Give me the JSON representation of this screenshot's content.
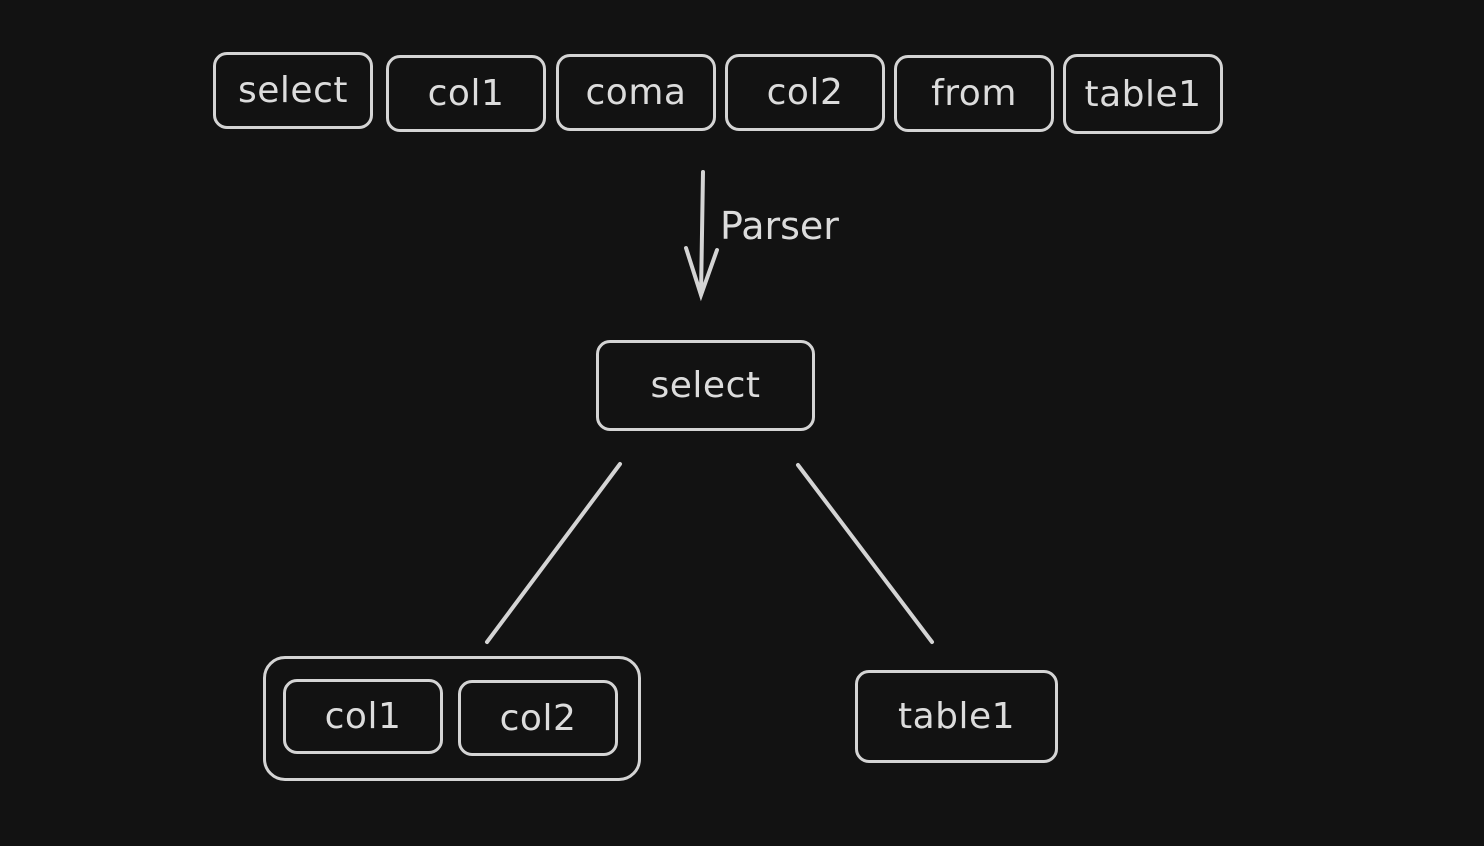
{
  "tokens": [
    "select",
    "col1",
    "coma",
    "col2",
    "from",
    "table1"
  ],
  "arrow_label": "Parser",
  "tree": {
    "root": "select",
    "columns_group": [
      "col1",
      "col2"
    ],
    "table": "table1"
  },
  "colors": {
    "background": "#121212",
    "stroke": "#d4d4d4"
  }
}
